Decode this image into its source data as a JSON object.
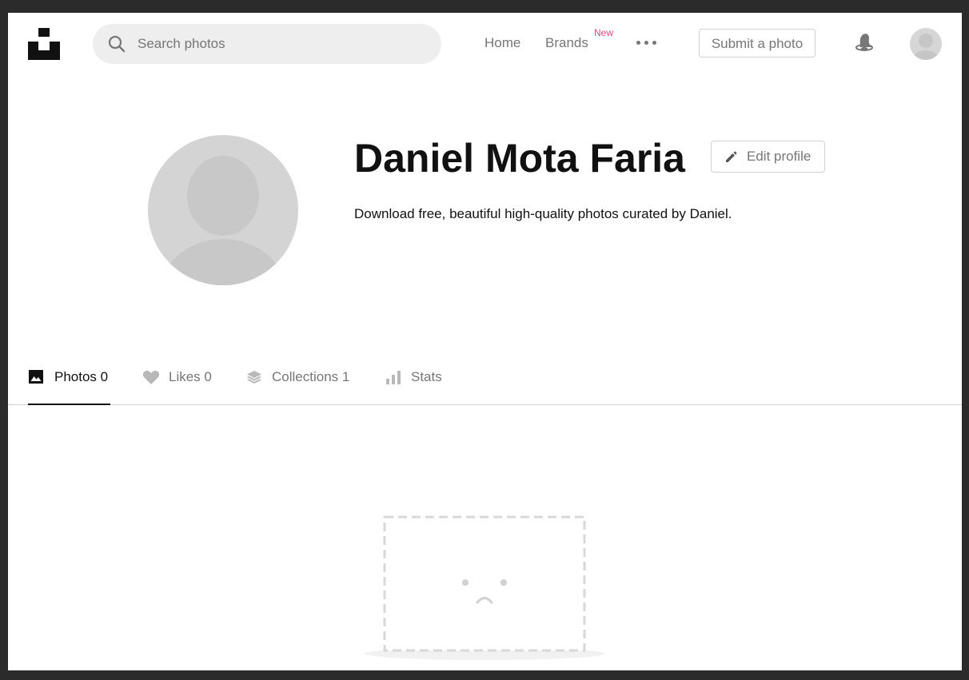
{
  "header": {
    "search": {
      "placeholder": "Search photos",
      "value": ""
    },
    "nav": {
      "home_label": "Home",
      "brands_label": "Brands",
      "brands_badge": "New"
    },
    "submit_label": "Submit a photo"
  },
  "profile": {
    "name": "Daniel Mota Faria",
    "edit_label": "Edit profile",
    "bio": "Download free, beautiful high-quality photos curated by Daniel."
  },
  "tabs": [
    {
      "label": "Photos 0",
      "icon": "image-icon",
      "active": true
    },
    {
      "label": "Likes 0",
      "icon": "heart-icon",
      "active": false
    },
    {
      "label": "Collections 1",
      "icon": "collections-icon",
      "active": false
    },
    {
      "label": "Stats",
      "icon": "stats-icon",
      "active": false
    }
  ],
  "colors": {
    "text_primary": "#111111",
    "text_secondary": "#767676",
    "badge_new": "#e0457b",
    "search_bg": "#eeeeee",
    "border": "#d1d1d1"
  }
}
